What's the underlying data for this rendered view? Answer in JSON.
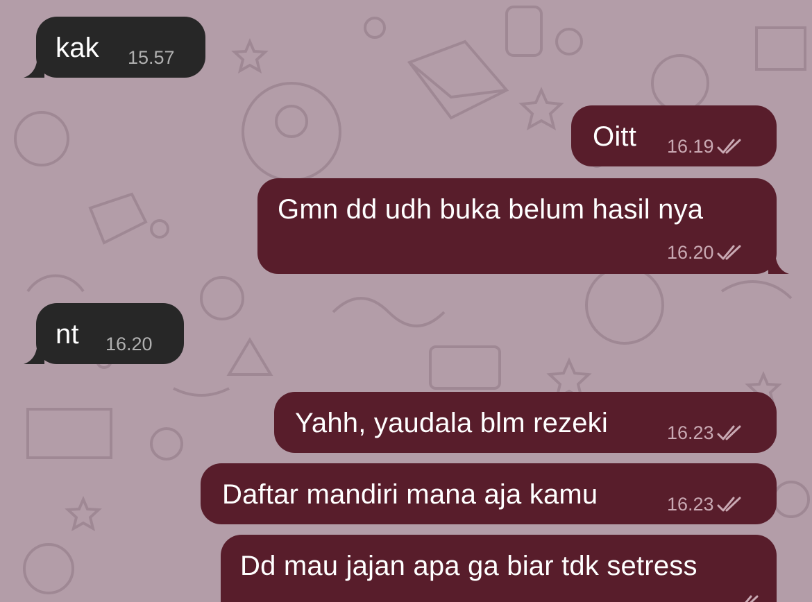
{
  "conversation": {
    "messages": [
      {
        "direction": "incoming",
        "text": "kak",
        "time": "15.57"
      },
      {
        "direction": "outgoing",
        "text": "Oitt",
        "time": "16.19",
        "status": "read-double-check-icon"
      },
      {
        "direction": "outgoing",
        "text": "Gmn dd udh buka belum hasil nya",
        "time": "16.20",
        "status": "read-double-check-icon"
      },
      {
        "direction": "incoming",
        "text": "nt",
        "time": "16.20"
      },
      {
        "direction": "outgoing",
        "text": "Yahh, yaudala blm rezeki",
        "time": "16.23",
        "status": "read-double-check-icon"
      },
      {
        "direction": "outgoing",
        "text": "Daftar mandiri mana aja kamu",
        "time": "16.23",
        "status": "read-double-check-icon"
      },
      {
        "direction": "outgoing",
        "text": "Dd mau jajan apa ga biar tdk setress",
        "time": "",
        "status": "read-double-check-icon"
      }
    ]
  },
  "theme": {
    "background": "#b39da8",
    "incoming_bubble": "#272727",
    "outgoing_bubble": "#581d2b"
  }
}
